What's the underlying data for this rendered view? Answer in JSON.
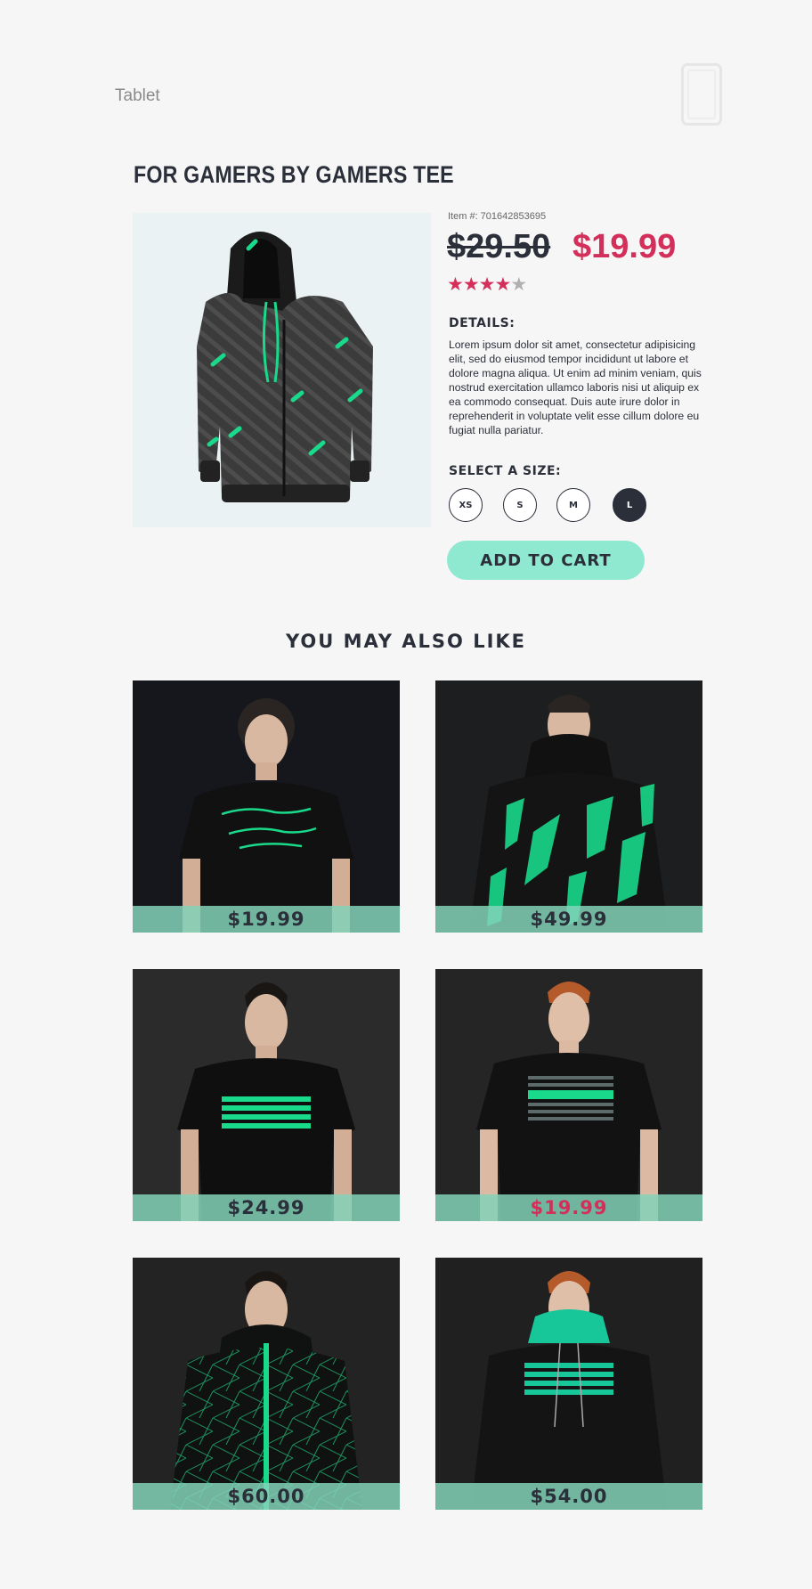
{
  "device": {
    "label": "Tablet",
    "icon": "tablet-icon"
  },
  "product": {
    "title": "FOR GAMERS BY GAMERS TEE",
    "item_number": "Item #: 701642853695",
    "price_old": "$29.50",
    "price_new": "$19.99",
    "rating": {
      "value": 4,
      "max": 5
    },
    "details_label": "DETAILS:",
    "details_text": "Lorem ipsum dolor sit amet, consectetur adipisicing elit, sed do eiusmod tempor incididunt ut labore et dolore magna aliqua. Ut enim ad minim veniam, quis nostrud exercitation ullamco laboris nisi ut aliquip ex ea commodo consequat. Duis aute irure dolor in reprehenderit in voluptate velit esse cillum dolore eu fugiat nulla pariatur.",
    "size_label": "SELECT A SIZE:",
    "sizes": [
      "XS",
      "S",
      "M",
      "L"
    ],
    "selected_size": "L",
    "add_to_cart_label": "ADD TO CART"
  },
  "recommendations": {
    "heading": "YOU MAY ALSO LIKE",
    "items": [
      {
        "price": "$19.99",
        "sale": true
      },
      {
        "price": "$49.99",
        "sale": false
      },
      {
        "price": "$24.99",
        "sale": false
      },
      {
        "price": "$19.99",
        "sale": true
      },
      {
        "price": "$60.00",
        "sale": false
      },
      {
        "price": "$54.00",
        "sale": false
      }
    ]
  },
  "colors": {
    "accent": "#8fe8d0",
    "sale": "#d32f5a",
    "text": "#2b2f3a",
    "green": "#19d98a"
  }
}
